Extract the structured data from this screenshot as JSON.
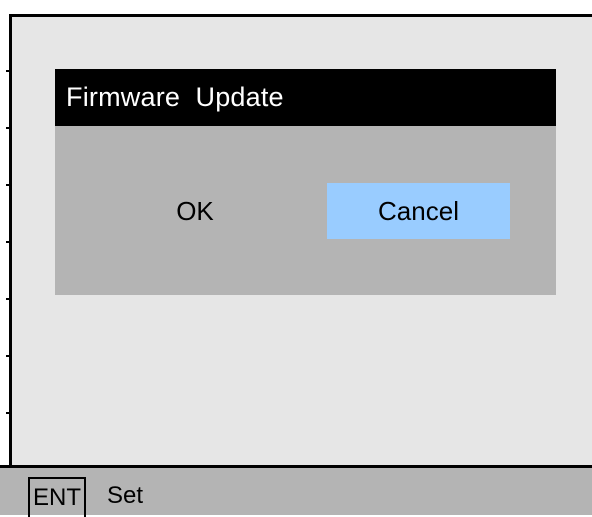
{
  "dialog": {
    "title": "Firmware  Update",
    "ok_label": "OK",
    "cancel_label": "Cancel",
    "selected": "Cancel",
    "selected_color": "#99ccff"
  },
  "footer": {
    "key": "ENT",
    "action": "Set"
  }
}
